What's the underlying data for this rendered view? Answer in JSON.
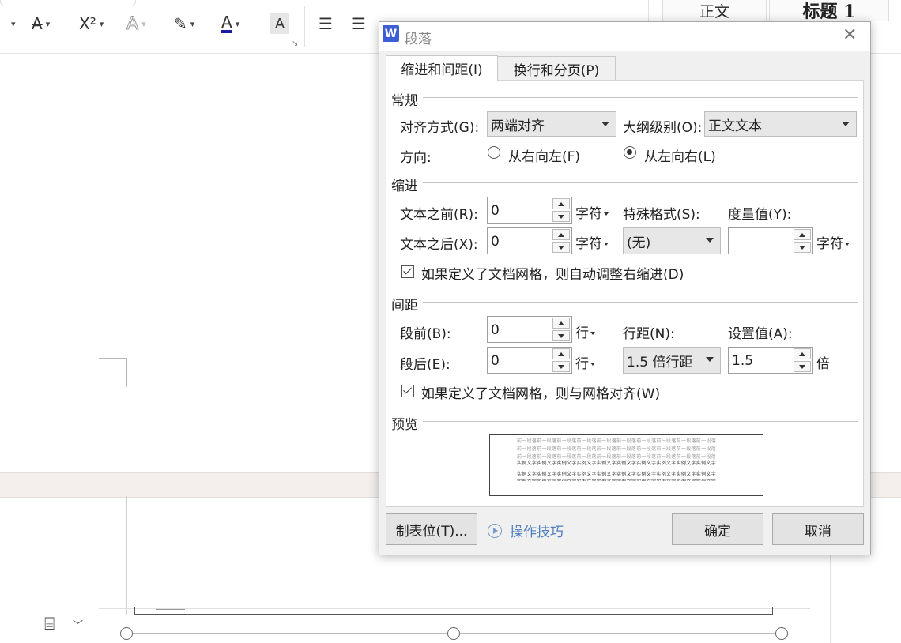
{
  "dialog": {
    "title": "段落",
    "tabs": [
      "缩进和间距(I)",
      "换行和分页(P)"
    ],
    "general": {
      "heading": "常规",
      "align_label": "对齐方式(G):",
      "align_value": "两端对齐",
      "outline_label": "大纲级别(O):",
      "outline_value": "正文文本",
      "direction_label": "方向:",
      "rtl_label": "从右向左(F)",
      "ltr_label": "从左向右(L)"
    },
    "indent": {
      "heading": "缩进",
      "before_label": "文本之前(R):",
      "before_value": "0",
      "before_unit": "字符",
      "after_label": "文本之后(X):",
      "after_value": "0",
      "after_unit": "字符",
      "special_label": "特殊格式(S):",
      "special_value": "(无)",
      "measure_label": "度量值(Y):",
      "measure_value": "",
      "measure_unit": "字符",
      "grid_checkbox": "如果定义了文档网格，则自动调整右缩进(D)"
    },
    "spacing": {
      "heading": "间距",
      "before_label": "段前(B):",
      "before_value": "0",
      "before_unit": "行",
      "after_label": "段后(E):",
      "after_value": "0",
      "after_unit": "行",
      "line_label": "行距(N):",
      "line_value": "1.5 倍行距",
      "set_label": "设置值(A):",
      "set_value": "1.5",
      "set_unit": "倍",
      "grid_checkbox": "如果定义了文档网格，则与网格对齐(W)"
    },
    "preview": {
      "heading": "预览",
      "prev_line": "前一段落前一段落前一段落前一段落前一段落前一段落前一段落前一段落前一段落前一段落",
      "cur_line": "实例文字实例文字实例文字实例文字实例文字实例文字实例文字实例文字实例文字实例文字"
    },
    "buttons": {
      "tabs": "制表位(T)...",
      "tips": "操作技巧",
      "ok": "确定",
      "cancel": "取消"
    }
  },
  "ribbon": {
    "font_color_letter": "A",
    "shade_letter": "A",
    "superscript": "X²",
    "style_normal": "正文",
    "style_heading1": "标题 1"
  },
  "colors": {
    "accent": "#3d5fd6",
    "font_color_bar": "#1a1aa6",
    "link": "#4e7fbf"
  }
}
